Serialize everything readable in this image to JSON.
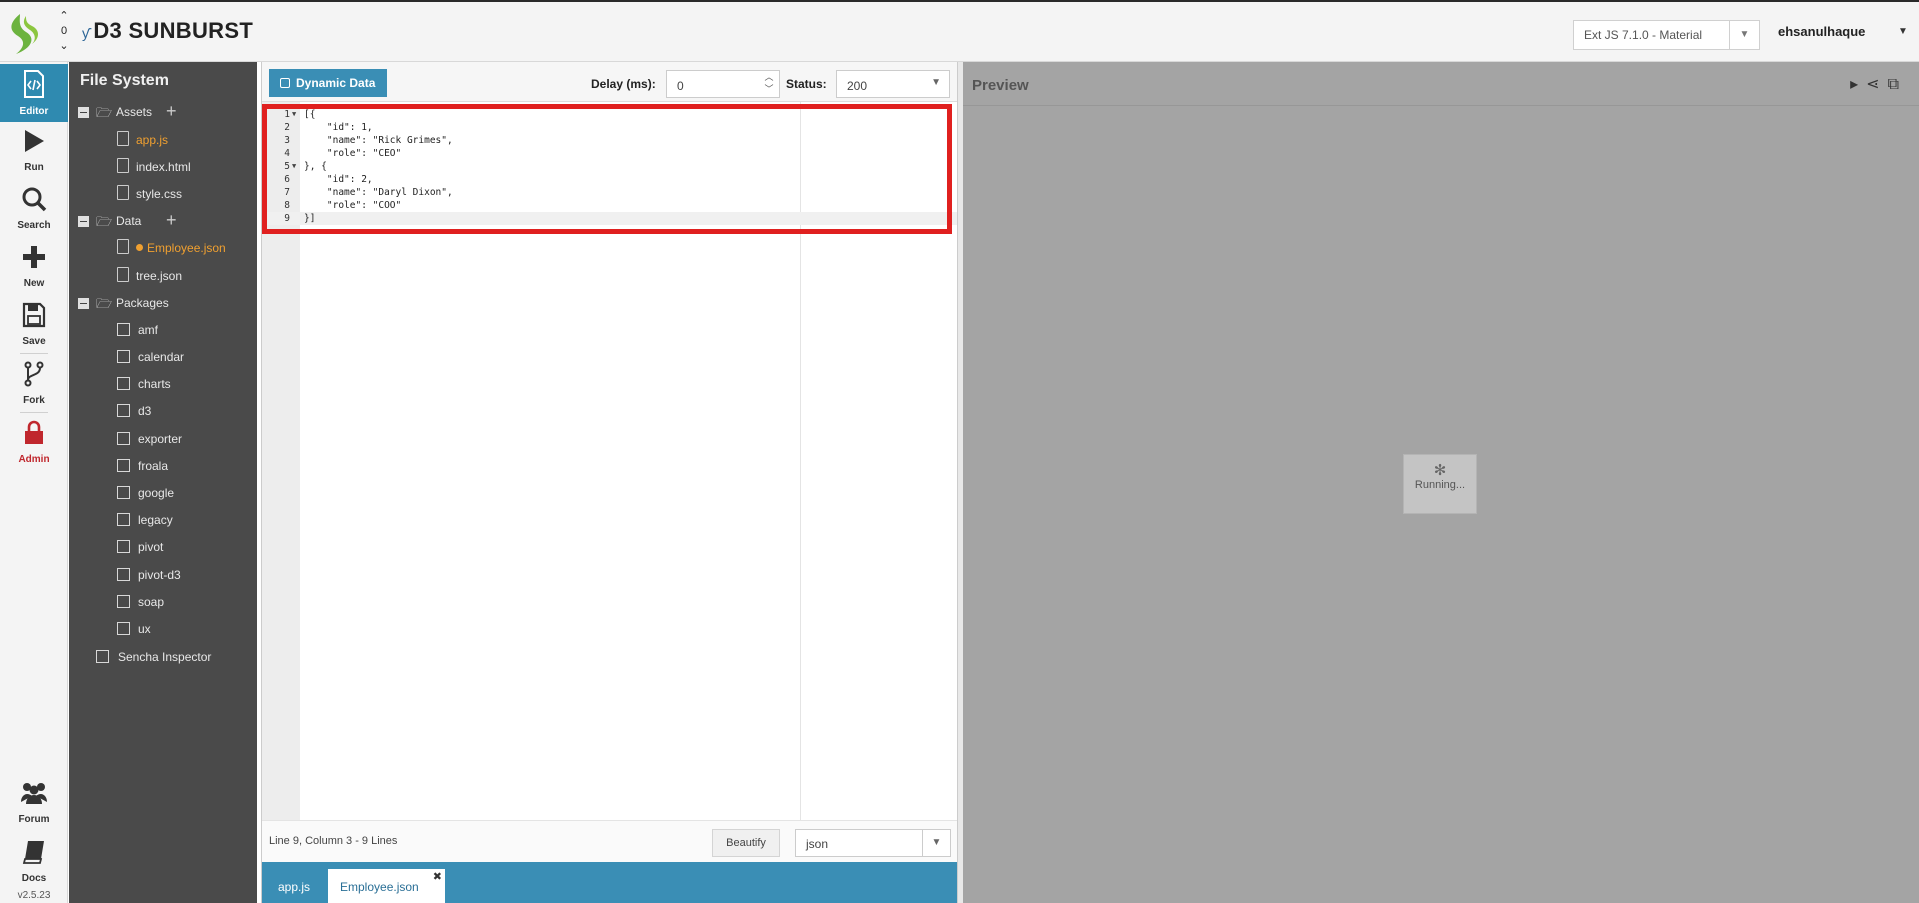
{
  "header": {
    "counter_up": "⌃",
    "counter_value": "0",
    "counter_down": "⌄",
    "fiddle_icon": "ƴ",
    "title": "D3 SUNBURST",
    "version_select": "Ext JS 7.1.0 - Material",
    "username": "ehsanulhaque"
  },
  "leftnav": {
    "items": [
      {
        "label": "Editor",
        "icon": "code-icon"
      },
      {
        "label": "Run",
        "icon": "play-icon"
      },
      {
        "label": "Search",
        "icon": "search-icon"
      },
      {
        "label": "New",
        "icon": "plus-icon"
      },
      {
        "label": "Save",
        "icon": "floppy-icon"
      },
      {
        "label": "Fork",
        "icon": "fork-icon"
      },
      {
        "label": "Admin",
        "icon": "lock-icon"
      },
      {
        "label": "Forum",
        "icon": "users-icon"
      },
      {
        "label": "Docs",
        "icon": "book-icon"
      }
    ],
    "version": "v2.5.23"
  },
  "filesystem": {
    "title": "File System",
    "folders": {
      "assets": "Assets",
      "data": "Data",
      "packages": "Packages"
    },
    "assets_files": [
      "app.js",
      "index.html",
      "style.css"
    ],
    "data_files": [
      "Employee.json",
      "tree.json"
    ],
    "packages": [
      "amf",
      "calendar",
      "charts",
      "d3",
      "exporter",
      "froala",
      "google",
      "legacy",
      "pivot",
      "pivot-d3",
      "soap",
      "ux"
    ],
    "inspector": "Sencha Inspector"
  },
  "editor": {
    "dynamic_data_label": "Dynamic Data",
    "delay_label": "Delay (ms):",
    "delay_value": "0",
    "status_label": "Status:",
    "status_value": "200",
    "cursor_info": "Line 9, Column 3 - 9 Lines",
    "beautify_label": "Beautify",
    "language_value": "json",
    "lines": [
      "[{",
      "    \"id\": 1,",
      "    \"name\": \"Rick Grimes\",",
      "    \"role\": \"CEO\"",
      "}, {",
      "    \"id\": 2,",
      "    \"name\": \"Daryl Dixon\",",
      "    \"role\": \"COO\"",
      "}]"
    ],
    "line_numbers": [
      "1",
      "2",
      "3",
      "4",
      "5",
      "6",
      "7",
      "8",
      "9"
    ],
    "tabs": [
      "app.js",
      "Employee.json"
    ]
  },
  "preview": {
    "title": "Preview",
    "running_text": "Running..."
  }
}
